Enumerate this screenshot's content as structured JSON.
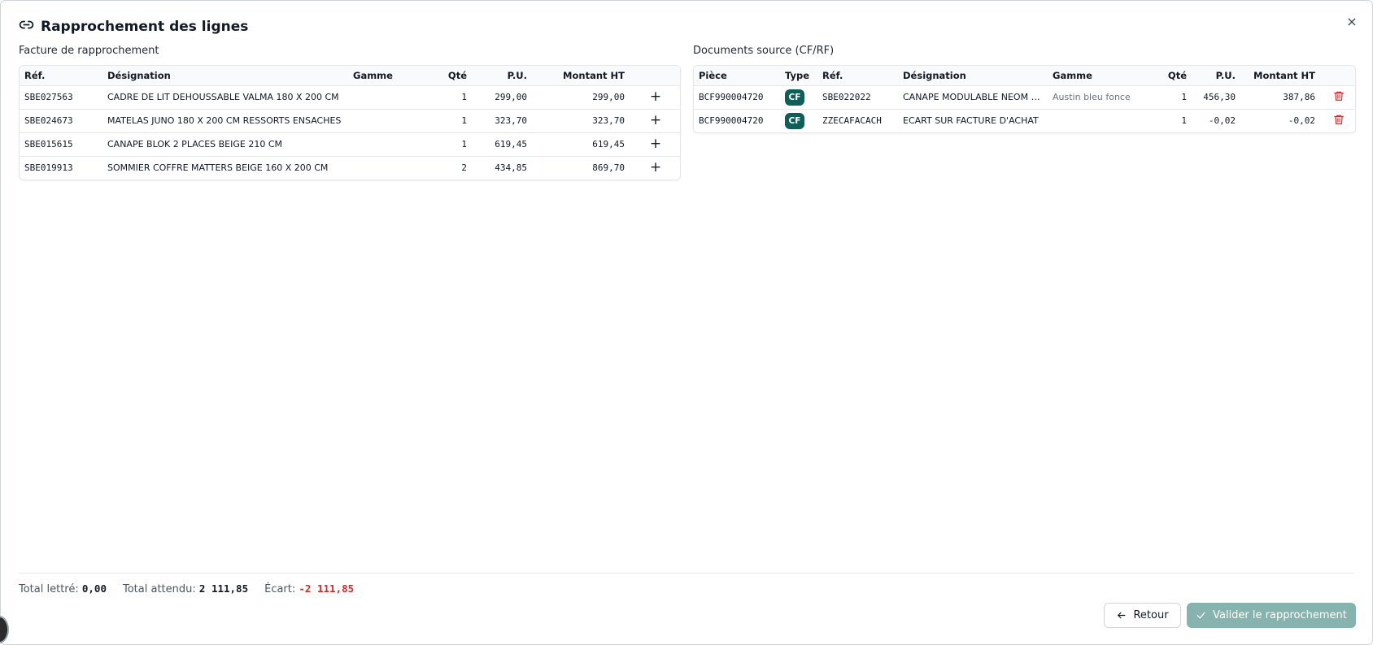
{
  "dialog": {
    "title": "Rapprochement des lignes",
    "close_label": "×"
  },
  "left": {
    "label": "Facture de rapprochement",
    "columns": [
      "Réf.",
      "Désignation",
      "Gamme",
      "Qté",
      "P.U.",
      "Montant HT"
    ],
    "rows": [
      {
        "ref": "SBE027563",
        "designation": "CADRE DE LIT DEHOUSSABLE VALMA 180 X 200 CM",
        "gamme": "",
        "qte": "1",
        "pu": "299,00",
        "montant": "299,00",
        "action": "+"
      },
      {
        "ref": "SBE024673",
        "designation": "MATELAS JUNO 180 X 200 CM RESSORTS ENSACHES",
        "gamme": "",
        "qte": "1",
        "pu": "323,70",
        "montant": "323,70",
        "action": "+"
      },
      {
        "ref": "SBE015615",
        "designation": "CANAPE BLOK 2 PLACES BEIGE 210 CM",
        "gamme": "",
        "qte": "1",
        "pu": "619,45",
        "montant": "619,45",
        "action": "+"
      },
      {
        "ref": "SBE019913",
        "designation": "SOMMIER COFFRE MATTERS BEIGE 160 X 200 CM",
        "gamme": "",
        "qte": "2",
        "pu": "434,85",
        "montant": "869,70",
        "action": "+"
      }
    ]
  },
  "right": {
    "label": "Documents source (CF/RF)",
    "columns": [
      "Pièce",
      "Type",
      "Réf.",
      "Désignation",
      "Gamme",
      "Qté",
      "P.U.",
      "Montant HT"
    ],
    "rows": [
      {
        "piece": "BCF990004720",
        "type": "CF",
        "ref": "SBE022022",
        "designation": "CANAPE MODULABLE NEOM 2 ...",
        "gamme": "Austin bleu fonce",
        "qte": "1",
        "pu": "456,30",
        "montant": "387,86"
      },
      {
        "piece": "BCF990004720",
        "type": "CF",
        "ref": "ZZECAFACACH",
        "designation": "ECART SUR FACTURE D'ACHAT",
        "gamme": "",
        "qte": "1",
        "pu": "-0,02",
        "montant": "-0,02"
      }
    ]
  },
  "totals": {
    "lettre_label": "Total lettré:",
    "lettre_value": "0,00",
    "attendu_label": "Total attendu:",
    "attendu_value": "2 111,85",
    "ecart_label": "Écart:",
    "ecart_value": "-2 111,85"
  },
  "buttons": {
    "back": "Retour",
    "validate": "Valider le rapprochement"
  },
  "colors": {
    "badge": "#0f5f59",
    "validate": "#86b3ae",
    "negative": "#dc2626",
    "trash": "#dc2626"
  },
  "icons": {
    "title": "link-icon",
    "close": "close-icon",
    "add": "plus-icon",
    "delete": "trash-icon",
    "back": "arrow-left-icon",
    "validate": "check-icon"
  }
}
